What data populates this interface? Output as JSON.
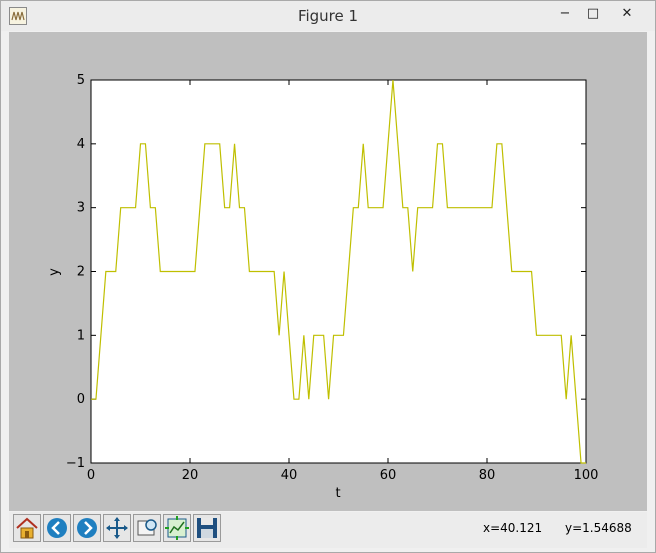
{
  "window": {
    "title": "Figure 1"
  },
  "window_buttons": {
    "minimize": "−",
    "maximize": "□",
    "close": "✕"
  },
  "toolbar": {
    "buttons": [
      "home-icon",
      "back-arrow-icon",
      "forward-arrow-icon",
      "pan-icon",
      "zoom-icon",
      "subplots-icon",
      "save-icon"
    ],
    "coord_x": "x=40.121",
    "coord_y": "y=1.54688"
  },
  "colors": {
    "line": "#bfbf00",
    "canvas_bg": "#bfbfbf",
    "plot_bg": "#ffffff"
  },
  "chart_data": {
    "type": "line",
    "xlabel": "t",
    "ylabel": "y",
    "xlim": [
      0,
      100
    ],
    "ylim": [
      -1,
      5
    ],
    "xticks": [
      0,
      20,
      40,
      60,
      80,
      100
    ],
    "yticks": [
      -1,
      0,
      1,
      2,
      3,
      4,
      5
    ],
    "grid": false,
    "series": [
      {
        "values": [
          0,
          0,
          1,
          2,
          2,
          2,
          3,
          3,
          3,
          3,
          4,
          4,
          3,
          3,
          2,
          2,
          2,
          2,
          2,
          2,
          2,
          2,
          3,
          4,
          4,
          4,
          4,
          3,
          3,
          4,
          3,
          3,
          2,
          2,
          2,
          2,
          2,
          2,
          1,
          2,
          1,
          0,
          0,
          1,
          0,
          1,
          1,
          1,
          0,
          1,
          1,
          1,
          2,
          3,
          3,
          4,
          3,
          3,
          3,
          3,
          4,
          5,
          4,
          3,
          3,
          2,
          3,
          3,
          3,
          3,
          4,
          4,
          3,
          3,
          3,
          3,
          3,
          3,
          3,
          3,
          3,
          3,
          4,
          4,
          3,
          2,
          2,
          2,
          2,
          2,
          1,
          1,
          1,
          1,
          1,
          1,
          0,
          1,
          0,
          -1,
          -1
        ]
      }
    ]
  }
}
